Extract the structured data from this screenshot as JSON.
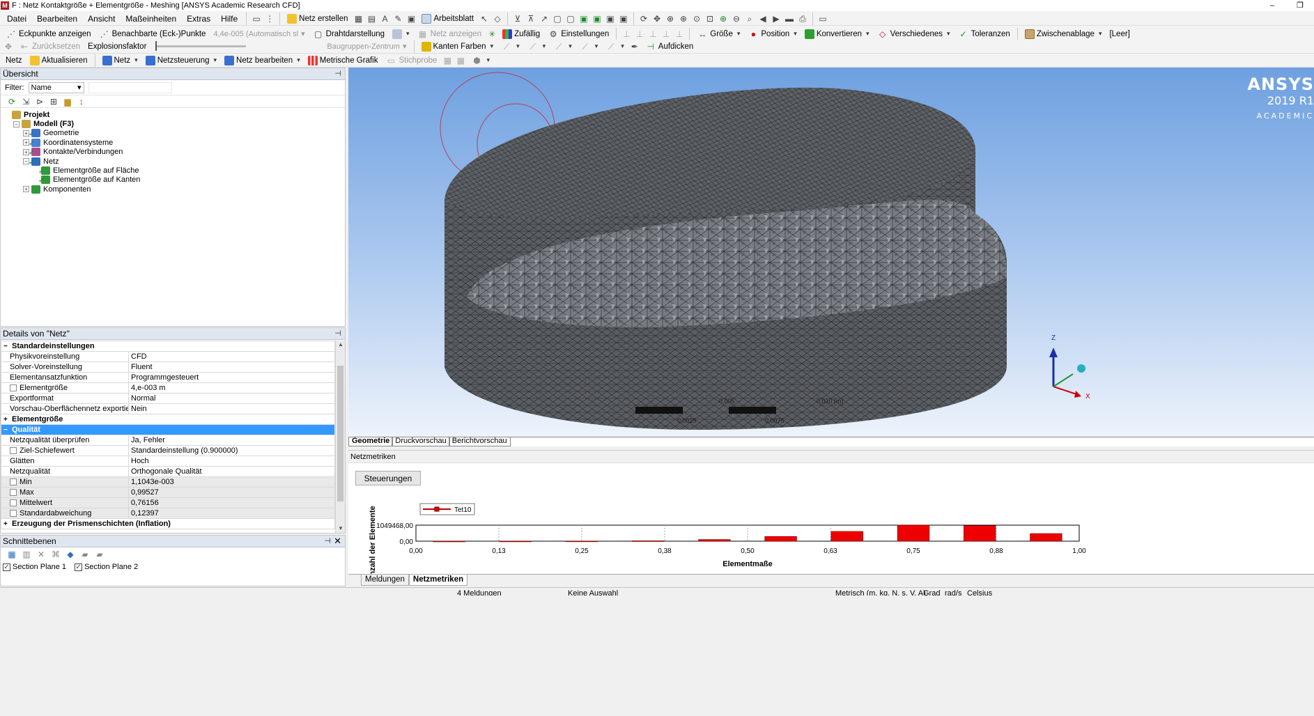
{
  "window": {
    "title": "F : Netz Kontaktgröße + Elementgröße - Meshing [ANSYS Academic Research CFD]",
    "controls": [
      "–",
      "❐"
    ]
  },
  "menu": [
    "Datei",
    "Bearbeiten",
    "Ansicht",
    "Maßeinheiten",
    "Extras",
    "Hilfe"
  ],
  "toolbar1": {
    "netz_erstellen": "Netz erstellen",
    "arbeitsblatt": "Arbeitsblatt"
  },
  "toolbar2": {
    "eckpunkte": "Eckpunkte anzeigen",
    "benachbarte": "Benachbarte (Eck-)Punkte",
    "scale_value": "4,4e-005 (Automatisch sl",
    "drahtdarstellung": "Drahtdarstellung",
    "netz_anzeigen": "Netz anzeigen",
    "zufaellig": "Zufällig",
    "einstellungen": "Einstellungen",
    "groesse": "Größe",
    "position": "Position",
    "konvertieren": "Konvertieren",
    "verschiedenes": "Verschiedenes",
    "toleranzen": "Toleranzen",
    "zwischenablage": "Zwischenablage",
    "leer": "[Leer]"
  },
  "toolbar3": {
    "zuruecksetzen": "Zurücksetzen",
    "explosionsfaktor": "Explosionsfaktor",
    "baugruppen": "Baugruppen-Zentrum",
    "kanten_farben": "Kanten Farben",
    "aufdicken": "Aufdicken"
  },
  "toolbar4": {
    "netz_label": "Netz",
    "aktualisieren": "Aktualisieren",
    "netz": "Netz",
    "netzsteuerung": "Netzsteuerung",
    "netz_bearbeiten": "Netz bearbeiten",
    "metrische_grafik": "Metrische Grafik",
    "stichprobe": "Stichprobe"
  },
  "outline": {
    "title": "Übersicht",
    "filter_label": "Filter:",
    "filter_value": "Name",
    "tree": [
      {
        "label": "Projekt",
        "level": 0,
        "bold": true,
        "expander": "",
        "icon": "#c8a23c"
      },
      {
        "label": "Modell (F3)",
        "level": 1,
        "bold": true,
        "expander": "−",
        "icon": "#c8a23c"
      },
      {
        "label": "Geometrie",
        "level": 2,
        "expander": "+",
        "icon": "#3d6fcf",
        "check": true
      },
      {
        "label": "Koordinatensysteme",
        "level": 2,
        "expander": "+",
        "icon": "#4a80d4",
        "check": true
      },
      {
        "label": "Kontakte/Verbindungen",
        "level": 2,
        "expander": "+",
        "icon": "#b04a8f",
        "check": true
      },
      {
        "label": "Netz",
        "level": 2,
        "expander": "−",
        "icon": "#2e6fc0",
        "check": true
      },
      {
        "label": "Elementgröße auf Fläche",
        "level": 3,
        "expander": "",
        "icon": "#2e9a3a",
        "check": true
      },
      {
        "label": "Elementgröße auf Kanten",
        "level": 3,
        "expander": "",
        "icon": "#2e9a3a",
        "check": true
      },
      {
        "label": "Komponenten",
        "level": 2,
        "expander": "+",
        "icon": "#2e9a3a"
      }
    ]
  },
  "details": {
    "title": "Details von \"Netz\"",
    "rows": [
      {
        "type": "group",
        "label": "Standardeinstellungen",
        "exp": "−"
      },
      {
        "label": "Physikvoreinstellung",
        "value": "CFD"
      },
      {
        "label": "Solver-Voreinstellung",
        "value": "Fluent"
      },
      {
        "label": "Elementansatzfunktion",
        "value": "Programmgesteuert"
      },
      {
        "label": "Elementgröße",
        "value": "4,e-003 m",
        "cb": true
      },
      {
        "label": "Exportformat",
        "value": "Normal"
      },
      {
        "label": "Vorschau-Oberflächennetz exportieren",
        "value": "Nein"
      },
      {
        "type": "group",
        "label": "Elementgröße",
        "exp": "+"
      },
      {
        "type": "group",
        "label": "Qualität",
        "exp": "−",
        "sel": true
      },
      {
        "label": "Netzqualität überprüfen",
        "value": "Ja, Fehler"
      },
      {
        "label": "Ziel-Schiefewert",
        "value": "Standardeinstellung (0.900000)",
        "cb": true
      },
      {
        "label": "Glätten",
        "value": "Hoch"
      },
      {
        "label": "Netzqualität",
        "value": "Orthogonale Qualität"
      },
      {
        "label": "Min",
        "value": "1,1043e-003",
        "cb": true,
        "shaded": true
      },
      {
        "label": "Max",
        "value": "0,99527",
        "cb": true,
        "shaded": true
      },
      {
        "label": "Mittelwert",
        "value": "0,76156",
        "cb": true,
        "shaded": true
      },
      {
        "label": "Standardabweichung",
        "value": "0,12397",
        "cb": true,
        "shaded": true
      },
      {
        "type": "group",
        "label": "Erzeugung der Prismenschichten (Inflation)",
        "exp": "+"
      }
    ]
  },
  "section_planes": {
    "title": "Schnittebenen",
    "items": [
      "Section Plane 1",
      "Section Plane 2"
    ]
  },
  "viewport": {
    "brand_1": "ANSYS",
    "brand_2": "2019 R1",
    "brand_3": "ACADEMIC",
    "scale_labels": [
      "0,005",
      "0,010 (m)",
      "0,0025",
      "0,0075"
    ],
    "triad": {
      "z": "Z",
      "x": "X"
    }
  },
  "view_tabs": [
    "Geometrie",
    "Druckvorschau",
    "Berichtvorschau"
  ],
  "metrics_panel": {
    "title": "Netzmetriken",
    "controls_button": "Steuerungen"
  },
  "chart_data": {
    "type": "bar",
    "xlabel": "Elementmaße",
    "ylabel": "Anzahl der Elemente",
    "legend": "Tet10",
    "series_color": "#ee0000",
    "ylim": [
      0,
      1049468
    ],
    "ytick_labels": [
      "0,00",
      "1049468,00"
    ],
    "xlim": [
      0,
      1
    ],
    "xtick_labels": [
      "0,00",
      "0,13",
      "0,25",
      "0,38",
      "0,50",
      "0,63",
      "0,75",
      "0,88",
      "1,00"
    ],
    "bin_centers": [
      0.05,
      0.15,
      0.25,
      0.35,
      0.45,
      0.55,
      0.65,
      0.75,
      0.85,
      0.95
    ],
    "bar_width": 0.048,
    "values": [
      2000,
      4000,
      8000,
      25000,
      110000,
      310000,
      640000,
      1049468,
      1020000,
      500000
    ]
  },
  "bottom_tabs": [
    "Meldungen",
    "Netzmetriken"
  ],
  "status": {
    "meldungen": "4 Meldungen",
    "auswahl": "Keine Auswahl",
    "units": "Metrisch (m, kg, N, s, V, A)",
    "grad": "Grad",
    "rads": "rad/s",
    "celsius": "Celsius"
  }
}
